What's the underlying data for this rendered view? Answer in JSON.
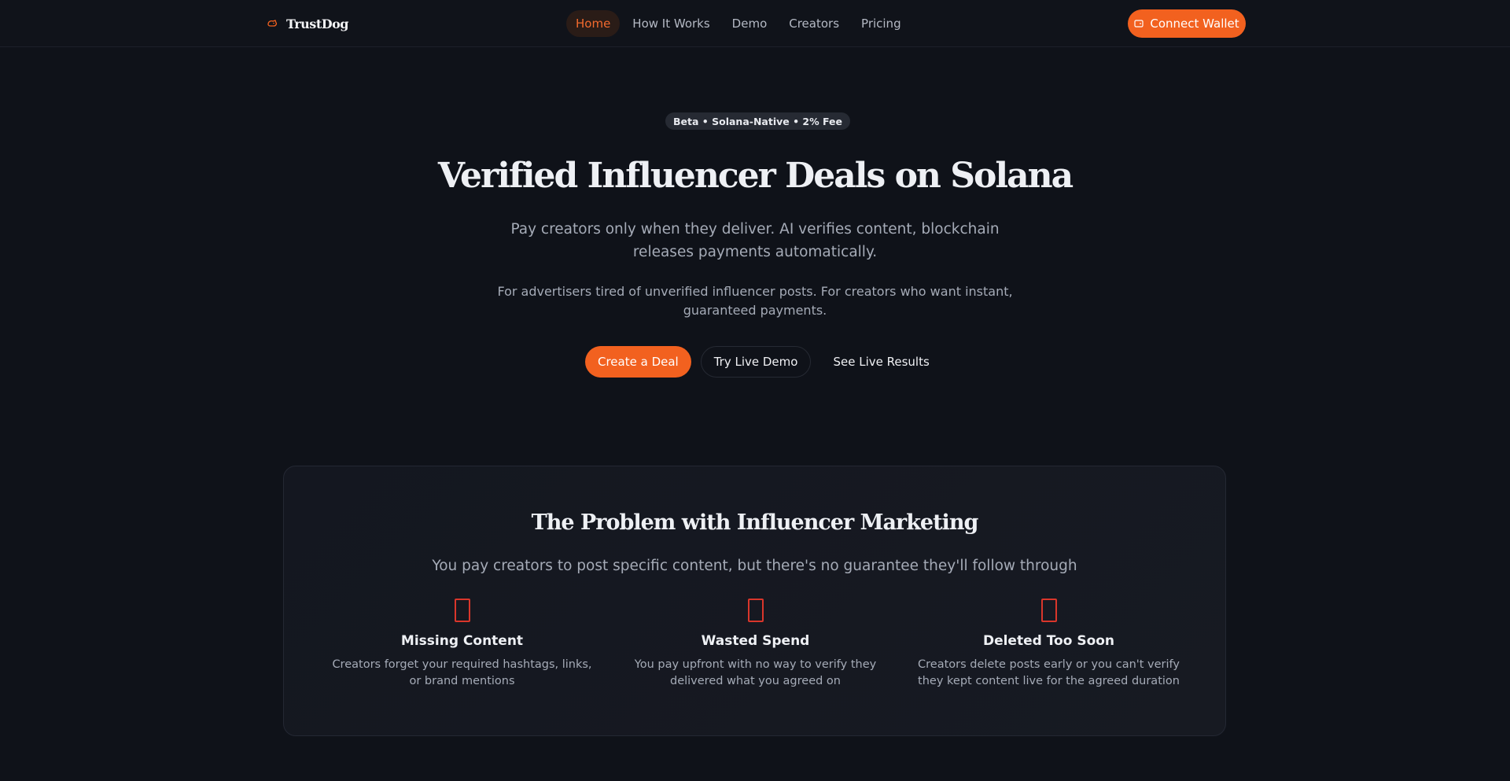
{
  "nav": {
    "brand": "TrustDog",
    "links": [
      {
        "label": "Home",
        "active": true
      },
      {
        "label": "How It Works",
        "active": false
      },
      {
        "label": "Demo",
        "active": false
      },
      {
        "label": "Creators",
        "active": false
      },
      {
        "label": "Pricing",
        "active": false
      }
    ],
    "connect_label": "Connect Wallet"
  },
  "hero": {
    "badge": "Beta • Solana-Native • 2% Fee",
    "title": "Verified Influencer Deals on Solana",
    "subtitle": "Pay creators only when they deliver. AI verifies content, blockchain releases payments automatically.",
    "description": "For advertisers tired of unverified influencer posts. For creators who want instant, guaranteed payments.",
    "cta_primary": "Create a Deal",
    "cta_secondary": "Try Live Demo",
    "cta_tertiary": "See Live Results"
  },
  "problem": {
    "title": "The Problem with Influencer Marketing",
    "subtitle": "You pay creators to post specific content, but there's no guarantee they'll follow through",
    "items": [
      {
        "icon": "missing-glyph-icon",
        "title": "Missing Content",
        "description": "Creators forget your required hashtags, links, or brand mentions"
      },
      {
        "icon": "missing-glyph-icon",
        "title": "Wasted Spend",
        "description": "You pay upfront with no way to verify they delivered what you agreed on"
      },
      {
        "icon": "missing-glyph-icon",
        "title": "Deleted Too Soon",
        "description": "Creators delete posts early or you can't verify they kept content live for the agreed duration"
      }
    ]
  },
  "colors": {
    "accent": "#f2611f",
    "background": "#0f1219",
    "problem_icon": "#d9362b"
  }
}
